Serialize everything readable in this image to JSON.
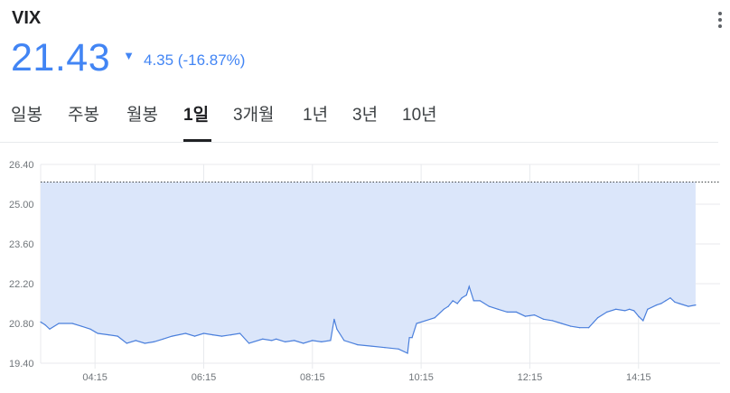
{
  "header": {
    "ticker": "VIX",
    "price": "21.43",
    "direction_icon": "triangle-down-icon",
    "change": "4.35 (-16.87%)"
  },
  "tabs": [
    {
      "label": "일봉",
      "active": false
    },
    {
      "label": "주봉",
      "active": false
    },
    {
      "label": "월봉",
      "active": false
    },
    {
      "label": "1일",
      "active": true
    },
    {
      "label": "3개월",
      "active": false
    },
    {
      "label": "1년",
      "active": false
    },
    {
      "label": "3년",
      "active": false
    },
    {
      "label": "10년",
      "active": false
    }
  ],
  "colors": {
    "accent": "#4285f4",
    "line": "#4a7fdc",
    "fill": "#dbe6fa",
    "grid": "#e8eaed",
    "text": "#202124"
  },
  "chart_data": {
    "type": "area",
    "title": "",
    "xlabel": "",
    "ylabel": "",
    "ylim": [
      19.4,
      26.4
    ],
    "y_ticks": [
      "26.40",
      "25.00",
      "23.60",
      "22.20",
      "20.80",
      "19.40"
    ],
    "x_ticks": [
      "04:15",
      "06:15",
      "08:15",
      "10:15",
      "12:15",
      "14:15"
    ],
    "x_tick_minutes": [
      255,
      375,
      495,
      615,
      735,
      855
    ],
    "xlim_minutes": [
      195,
      945
    ],
    "previous_close": 25.78,
    "grid": true,
    "legend": "none",
    "series": [
      {
        "x_minutes": [
          195,
          200,
          205,
          215,
          230,
          240,
          250,
          258,
          270,
          280,
          290,
          300,
          310,
          320,
          330,
          340,
          355,
          365,
          375,
          385,
          395,
          405,
          415,
          425,
          440,
          450,
          455,
          465,
          475,
          485,
          495,
          505,
          515,
          519,
          522,
          530,
          545,
          560,
          575,
          590,
          600,
          602,
          605,
          610,
          620,
          630,
          640,
          645,
          650,
          655,
          660,
          665,
          668,
          673,
          680,
          690,
          700,
          710,
          720,
          730,
          740,
          750,
          760,
          770,
          780,
          790,
          800,
          810,
          820,
          830,
          840,
          845,
          850,
          855,
          860,
          865,
          875,
          880,
          885,
          890,
          895,
          900,
          910,
          918
        ],
        "values": [
          20.85,
          20.75,
          20.6,
          20.8,
          20.8,
          20.7,
          20.6,
          20.45,
          20.4,
          20.35,
          20.1,
          20.2,
          20.1,
          20.15,
          20.25,
          20.35,
          20.45,
          20.35,
          20.45,
          20.4,
          20.35,
          20.4,
          20.45,
          20.1,
          20.25,
          20.2,
          20.25,
          20.15,
          20.2,
          20.1,
          20.2,
          20.15,
          20.2,
          20.95,
          20.6,
          20.2,
          20.05,
          20.0,
          19.95,
          19.9,
          19.75,
          20.3,
          20.3,
          20.8,
          20.9,
          21.0,
          21.3,
          21.4,
          21.6,
          21.5,
          21.7,
          21.8,
          22.1,
          21.6,
          21.6,
          21.4,
          21.3,
          21.2,
          21.2,
          21.05,
          21.1,
          20.95,
          20.9,
          20.8,
          20.7,
          20.65,
          20.65,
          21.0,
          21.2,
          21.3,
          21.25,
          21.3,
          21.25,
          21.05,
          20.9,
          21.3,
          21.45,
          21.5,
          21.6,
          21.7,
          21.55,
          21.5,
          21.4,
          21.45
        ]
      }
    ]
  }
}
